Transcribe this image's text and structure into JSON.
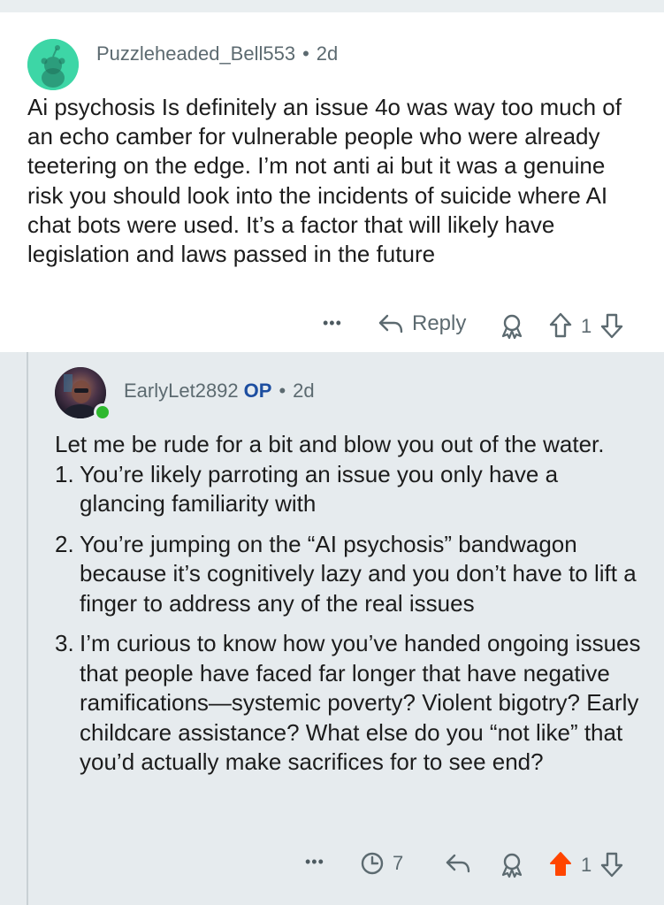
{
  "comment": {
    "author": "Puzzleheaded_Bell553",
    "separator": "•",
    "age": "2d",
    "text": "Ai psychosis Is definitely an issue 4o was way too much of an echo camber for vulnerable people who were already teetering on the edge. I’m not anti ai but it was a genuine risk you should look into the incidents of suicide where AI chat bots were used. It’s a factor that will likely have legislation and laws passed in the future",
    "actions": {
      "more": "•••",
      "reply": "Reply",
      "vote_count": "1"
    }
  },
  "reply": {
    "author": "EarlyLet2892",
    "op_badge": "OP",
    "separator": "•",
    "age": "2d",
    "intro": "Let me be rude for a bit and blow you out of the water.",
    "list": [
      {
        "num": "1.",
        "text": "You’re likely parroting an issue you only have a glancing familiarity with"
      },
      {
        "num": "2.",
        "text": "You’re jumping on the “AI psychosis” bandwagon because it’s cognitively lazy and you don’t have to lift a finger to address any of the real issues"
      },
      {
        "num": "3.",
        "text": "I’m curious to know how you’ve handed ongoing issues that people have faced far longer that have negative ramifications—systemic poverty? Violent bigotry? Early childcare assistance? What else do you “not like” that you’d actually make sacrifices for to see end?"
      }
    ],
    "actions": {
      "more": "•••",
      "reply_count": "7",
      "vote_count": "1",
      "upvoted": true
    }
  },
  "colors": {
    "meta_text": "#5c6a70",
    "op_badge": "#1d4ea0",
    "upvote_active": "#ff4500",
    "reply_bg": "#e6ebee",
    "avatar_green": "#3dd6a6",
    "online_dot": "#2eb82e"
  },
  "icons": [
    "snoo-avatar-icon",
    "more-icon",
    "reply-arrow-icon",
    "award-icon",
    "upvote-icon",
    "downvote-icon",
    "clock-icon",
    "online-status-icon"
  ]
}
